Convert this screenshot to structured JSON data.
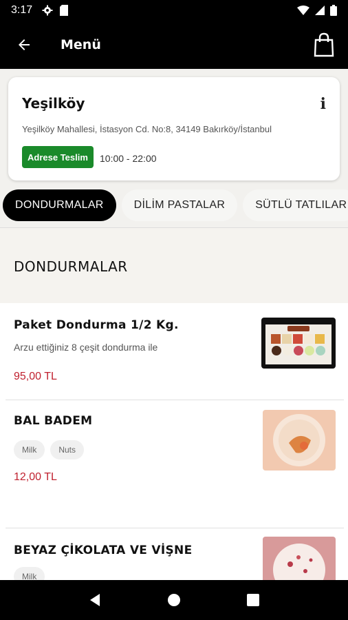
{
  "status_bar": {
    "time": "3:17"
  },
  "app_bar": {
    "title": "Menü"
  },
  "store": {
    "name": "Yeşilköy",
    "address": "Yeşilköy Mahallesi, İstasyon Cd. No:8, 34149 Bakırköy/İstanbul",
    "delivery_label": "Adrese Teslim",
    "hours": "10:00 - 22:00"
  },
  "tabs": [
    {
      "label": "DONDURMALAR",
      "active": true
    },
    {
      "label": "DİLİM PASTALAR",
      "active": false
    },
    {
      "label": "SÜTLÜ TATLILAR",
      "active": false
    }
  ],
  "section": {
    "title": "DONDURMALAR"
  },
  "products": [
    {
      "name": "Paket Dondurma 1/2 Kg.",
      "description": "Arzu ettiğiniz 8 çeşit dondurma ile",
      "price": "95,00 TL",
      "tags": []
    },
    {
      "name": "BAL BADEM",
      "description": "",
      "price": "12,00 TL",
      "tags": [
        "Milk",
        "Nuts"
      ]
    },
    {
      "name": "BEYAZ ÇİKOLATA VE VİŞNE",
      "description": "",
      "price": "",
      "tags": [
        "Milk"
      ]
    }
  ],
  "colors": {
    "accent_price": "#c0212f",
    "delivery_badge": "#1a8a2a",
    "header_bg": "#000000"
  }
}
